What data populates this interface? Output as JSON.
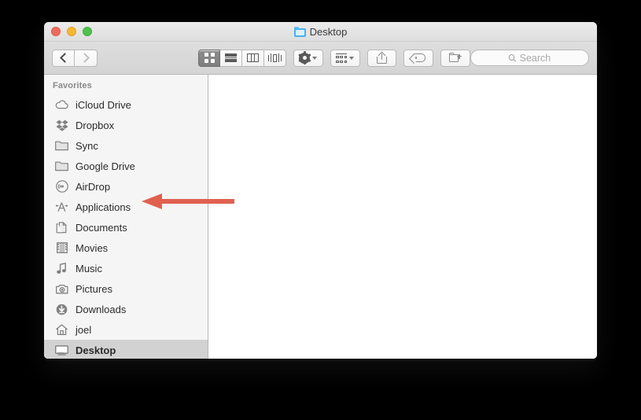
{
  "window": {
    "title": "Desktop",
    "title_icon": "blue-folder-icon",
    "traffic_lights": [
      {
        "name": "close",
        "color": "#ef6b5e"
      },
      {
        "name": "minimize",
        "color": "#f7b731"
      },
      {
        "name": "zoom",
        "color": "#4ec24a"
      }
    ]
  },
  "toolbar": {
    "back_label": "Back",
    "forward_label": "Forward",
    "view_modes": [
      {
        "name": "icon-view",
        "label": "Icon View",
        "active": true
      },
      {
        "name": "list-view",
        "label": "List View",
        "active": false
      },
      {
        "name": "column-view",
        "label": "Column View",
        "active": false
      },
      {
        "name": "coverflow-view",
        "label": "Cover Flow View",
        "active": false
      }
    ],
    "action_label": "Action",
    "arrange_label": "Arrange",
    "share_label": "Share",
    "tag_label": "Edit Tags",
    "new_folder_label": "New Folder"
  },
  "search": {
    "placeholder": "Search",
    "value": ""
  },
  "sidebar": {
    "section_title": "Favorites",
    "items": [
      {
        "label": "iCloud Drive",
        "icon": "icloud-drive-icon",
        "selected": false
      },
      {
        "label": "Dropbox",
        "icon": "dropbox-icon",
        "selected": false
      },
      {
        "label": "Sync",
        "icon": "folder-icon",
        "selected": false
      },
      {
        "label": "Google Drive",
        "icon": "folder-icon",
        "selected": false
      },
      {
        "label": "AirDrop",
        "icon": "airdrop-icon",
        "selected": false
      },
      {
        "label": "Applications",
        "icon": "applications-icon",
        "selected": false
      },
      {
        "label": "Documents",
        "icon": "documents-icon",
        "selected": false
      },
      {
        "label": "Movies",
        "icon": "movies-icon",
        "selected": false
      },
      {
        "label": "Music",
        "icon": "music-icon",
        "selected": false
      },
      {
        "label": "Pictures",
        "icon": "pictures-icon",
        "selected": false
      },
      {
        "label": "Downloads",
        "icon": "downloads-icon",
        "selected": false
      },
      {
        "label": "joel",
        "icon": "home-icon",
        "selected": false
      },
      {
        "label": "Desktop",
        "icon": "desktop-icon",
        "selected": true
      }
    ]
  },
  "annotation": {
    "arrow_color": "#e0604f",
    "points_to": "Applications"
  },
  "colors": {
    "background": "#000000",
    "sidebar": "#f5f5f5",
    "content": "#ffffff",
    "selection": "#d2d2d2",
    "titlebar_top": "#ebebeb",
    "titlebar_bottom": "#dedede"
  }
}
